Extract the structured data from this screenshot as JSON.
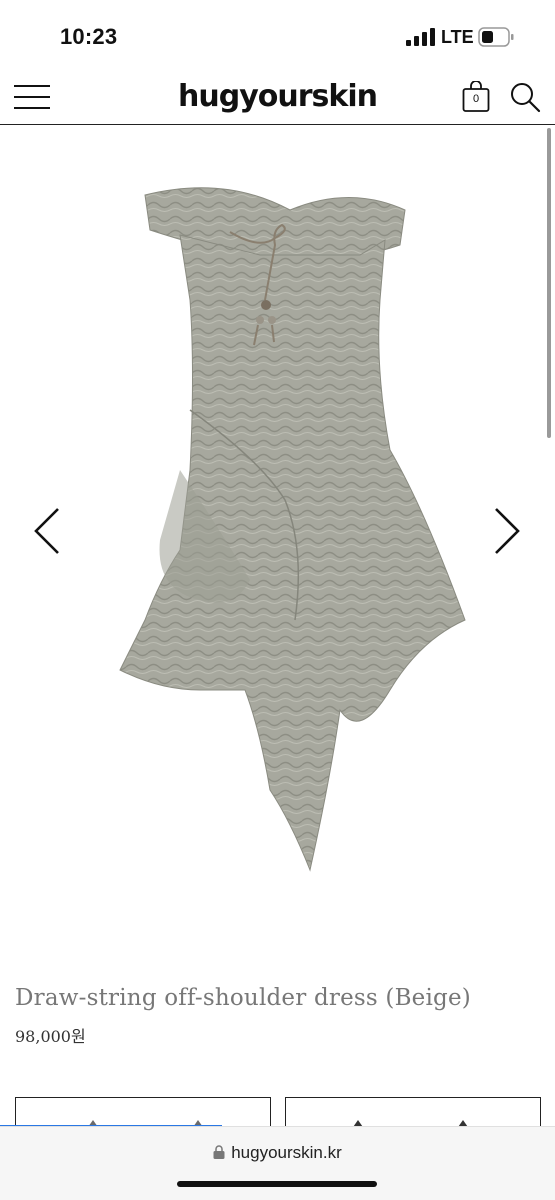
{
  "status_bar": {
    "time": "10:23",
    "network": "LTE",
    "signal_icon": "cellular-signal-icon",
    "battery_icon": "battery-icon"
  },
  "header": {
    "logo": "hugyourskin",
    "menu_icon": "hamburger-menu-icon",
    "cart_icon": "shopping-bag-icon",
    "cart_count": "0",
    "search_icon": "search-icon"
  },
  "product": {
    "image_alt": "Draw-string off-shoulder dress (Beige)",
    "name": "Draw-string off-shoulder dress (Beige)",
    "price": "98,000원",
    "prev_icon": "chevron-left-icon",
    "next_icon": "chevron-right-icon",
    "dress_color": "#a7a89e"
  },
  "browser": {
    "url": "hugyourskin.kr",
    "lock_icon": "lock-icon",
    "load_progress": 0.4
  }
}
